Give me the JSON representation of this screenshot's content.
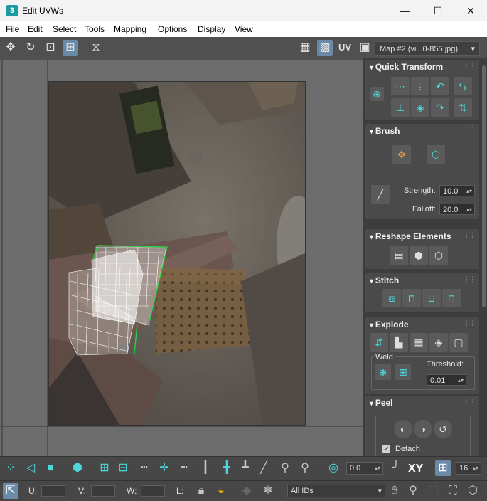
{
  "window": {
    "app_icon": "3",
    "title": "Edit UVWs",
    "minimize": "—",
    "maximize": "☐",
    "close": "✕"
  },
  "menu": [
    "File",
    "Edit",
    "Select",
    "Tools",
    "Mapping",
    "Options",
    "Display",
    "View"
  ],
  "toolbar": {
    "uv_label": "UV",
    "map_select": "Map #2 (vi...0-855.jpg)"
  },
  "panel": {
    "quick_transform": {
      "title": "Quick Transform"
    },
    "brush": {
      "title": "Brush",
      "strength_label": "Strength:",
      "strength_value": "10.0",
      "falloff_label": "Falloff:",
      "falloff_value": "20.0"
    },
    "reshape": {
      "title": "Reshape Elements"
    },
    "stitch": {
      "title": "Stitch"
    },
    "explode": {
      "title": "Explode",
      "weld_label": "Weld",
      "threshold_label": "Threshold:",
      "threshold_value": "0.01"
    },
    "peel": {
      "title": "Peel",
      "detach_label": "Detach"
    }
  },
  "bottom": {
    "angle_value": "0.0",
    "xy_label": "XY",
    "grid_value": "16",
    "u_label": "U:",
    "v_label": "V:",
    "w_label": "W:",
    "l_label": "L:",
    "ids_select": "All IDs"
  },
  "colors": {
    "accent": "#4dd6db",
    "panel_bg": "#3d3d3d",
    "rollout_bg": "#4a4a4a",
    "wire_selected": "#2ecc40",
    "wire": "#ffffff"
  }
}
